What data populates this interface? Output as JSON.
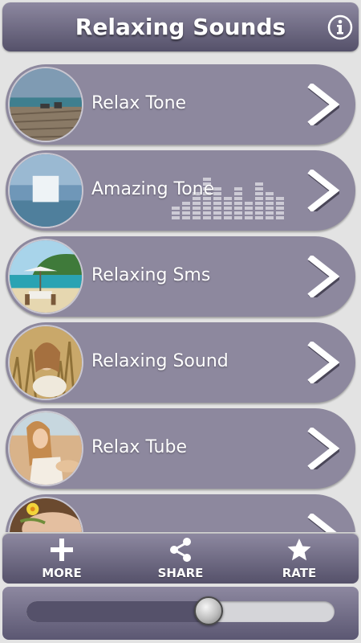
{
  "header": {
    "title": "Relaxing Sounds",
    "info_icon": "info-icon"
  },
  "list": {
    "items": [
      {
        "label": "Relax Tone",
        "thumb": "beach-deck-photo"
      },
      {
        "label": "Amazing Tone",
        "thumb": "equalizer-photo"
      },
      {
        "label": "Relaxing Sms",
        "thumb": "tropical-beach-photo"
      },
      {
        "label": "Relaxing Sound",
        "thumb": "woman-grass-photo"
      },
      {
        "label": "Relax Tube",
        "thumb": "woman-beach-photo"
      },
      {
        "label": "",
        "thumb": "spa-flower-photo"
      }
    ]
  },
  "bottom_bar": {
    "more_label": "MORE",
    "share_label": "SHARE",
    "rate_label": "RATE"
  },
  "volume": {
    "level": 0.59
  },
  "colors": {
    "accent": "#8d889e",
    "header_dark": "#55516a",
    "background": "#e3e3e3"
  }
}
